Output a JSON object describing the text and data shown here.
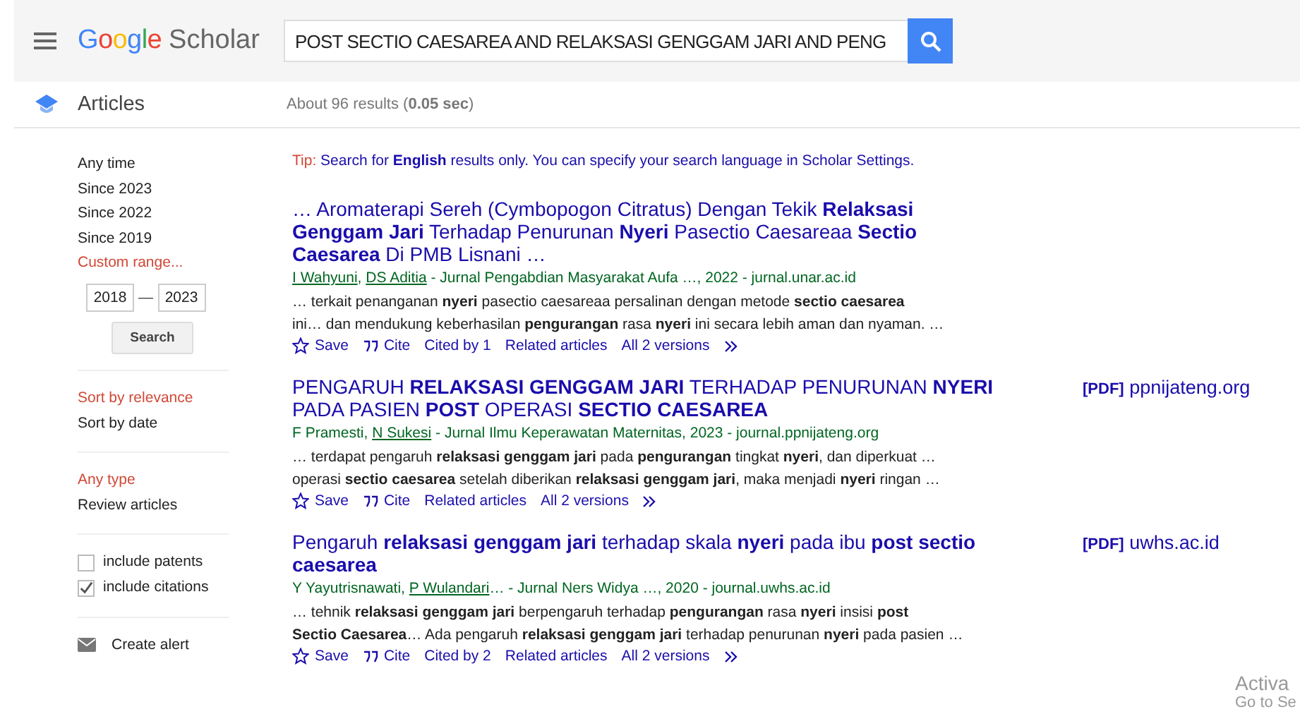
{
  "header": {
    "logo_colored": "Google",
    "logo_text": "Scholar",
    "query": "POST SECTIO CAESAREA AND RELAKSASI GENGGAM JARI AND PENG"
  },
  "subheader": {
    "title": "Articles",
    "stats": "About 96 results (**0.05 sec**)"
  },
  "sidebar": {
    "time_filters": [
      {
        "label": "Any time",
        "selected": false
      },
      {
        "label": "Since 2023",
        "selected": false
      },
      {
        "label": "Since 2022",
        "selected": false
      },
      {
        "label": "Since 2019",
        "selected": false
      },
      {
        "label": "Custom range...",
        "selected": true
      }
    ],
    "range_from": "2018",
    "range_to": "2023",
    "range_dash": "—",
    "range_button": "Search",
    "sort": [
      {
        "label": "Sort by relevance",
        "selected": true
      },
      {
        "label": "Sort by date",
        "selected": false
      }
    ],
    "types": [
      {
        "label": "Any type",
        "selected": true
      },
      {
        "label": "Review articles",
        "selected": false
      }
    ],
    "checkboxes": [
      {
        "label": "include patents",
        "checked": false
      },
      {
        "label": "include citations",
        "checked": true
      }
    ],
    "alert": "Create alert"
  },
  "tip": {
    "prefix": "Tip:",
    "text": "Search for **English** results only. You can specify your search language in Scholar Settings."
  },
  "results": [
    {
      "title": "… Aromaterapi Sereh (Cymbopogon Citratus) Dengan Tekik **Relaksasi Genggam Jari** Terhadap Penurunan **Nyeri** Pasectio Caesareaa **Sectio Caesarea** Di PMB Lisnani …",
      "authors": [
        {
          "name": "I Wahyuni",
          "linked": true
        },
        {
          "name": ", ",
          "linked": false
        },
        {
          "name": "DS Aditia",
          "linked": true
        }
      ],
      "source": " - Jurnal Pengabdian Masyarakat Aufa …, 2022 - jurnal.unar.ac.id",
      "snippet": [
        "… terkait penanganan **nyeri** pasectio caesareaa persalinan dengan metode **sectio caesarea**",
        "ini… dan mendukung keberhasilan **pengurangan** rasa **nyeri** ini secara lebih aman dan nyaman. …"
      ],
      "actions": [
        {
          "kind": "save",
          "label": "Save"
        },
        {
          "kind": "cite",
          "label": "Cite"
        },
        {
          "kind": "link",
          "label": "Cited by 1"
        },
        {
          "kind": "link",
          "label": "Related articles"
        },
        {
          "kind": "link",
          "label": "All 2 versions"
        },
        {
          "kind": "more"
        }
      ]
    },
    {
      "title": "PENGARUH **RELAKSASI GENGGAM JARI** TERHADAP PENURUNAN **NYERI** PADA PASIEN **POST** OPERASI **SECTIO CAESAREA**",
      "side": {
        "tag": "[PDF]",
        "domain": "ppnijateng.org"
      },
      "authors": [
        {
          "name": "F Pramesti, ",
          "linked": false
        },
        {
          "name": "N Sukesi",
          "linked": true
        }
      ],
      "source": " - Jurnal Ilmu Keperawatan Maternitas, 2023 - journal.ppnijateng.org",
      "snippet": [
        "… terdapat pengaruh **relaksasi genggam jari** pada **pengurangan** tingkat **nyeri**, dan diperkuat …",
        "operasi **sectio caesarea** setelah diberikan **relaksasi genggam jari**, maka menjadi **nyeri** ringan …"
      ],
      "actions": [
        {
          "kind": "save",
          "label": "Save"
        },
        {
          "kind": "cite",
          "label": "Cite"
        },
        {
          "kind": "link",
          "label": "Related articles"
        },
        {
          "kind": "link",
          "label": "All 2 versions"
        },
        {
          "kind": "more"
        }
      ]
    },
    {
      "title": "Pengaruh **relaksasi genggam jari** terhadap skala **nyeri** pada ibu **post sectio caesarea**",
      "side": {
        "tag": "[PDF]",
        "domain": "uwhs.ac.id"
      },
      "authors": [
        {
          "name": "Y Yayutrisnawati, ",
          "linked": false
        },
        {
          "name": "P Wulandari",
          "linked": true
        }
      ],
      "source": "… - Jurnal Ners Widya …, 2020 - journal.uwhs.ac.id",
      "snippet": [
        "… tehnik **relaksasi genggam jari** berpengaruh terhadap **pengurangan** rasa **nyeri** insisi **post**",
        "**Sectio Caesarea**… Ada pengaruh **relaksasi genggam jari** terhadap penurunan **nyeri** pada pasien …"
      ],
      "actions": [
        {
          "kind": "save",
          "label": "Save"
        },
        {
          "kind": "cite",
          "label": "Cite"
        },
        {
          "kind": "link",
          "label": "Cited by 2"
        },
        {
          "kind": "link",
          "label": "Related articles"
        },
        {
          "kind": "link",
          "label": "All 2 versions"
        },
        {
          "kind": "more"
        }
      ]
    }
  ],
  "activation": {
    "line1": "Activa",
    "line2": "Go to Se"
  }
}
